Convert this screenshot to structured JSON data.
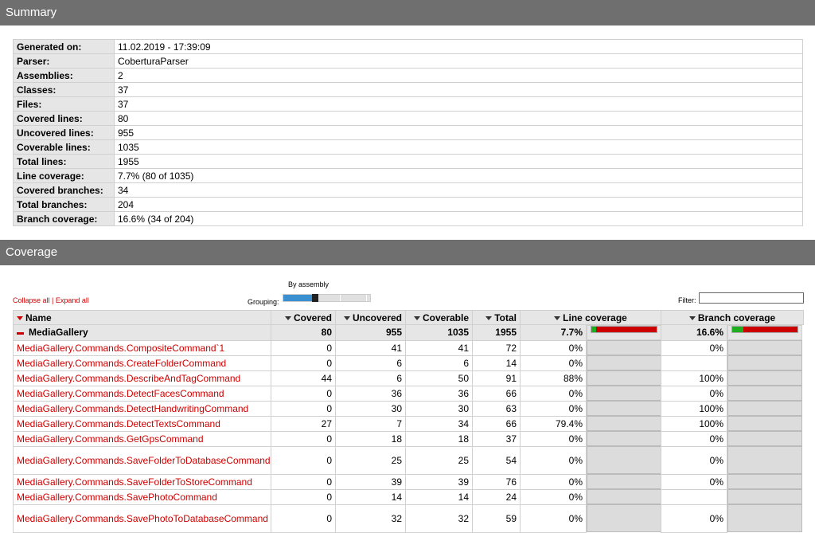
{
  "summary_title": "Summary",
  "summary": [
    {
      "label": "Generated on:",
      "value": "11.02.2019 - 17:39:09"
    },
    {
      "label": "Parser:",
      "value": "CoberturaParser"
    },
    {
      "label": "Assemblies:",
      "value": "2"
    },
    {
      "label": "Classes:",
      "value": "37"
    },
    {
      "label": "Files:",
      "value": "37"
    },
    {
      "label": "Covered lines:",
      "value": "80"
    },
    {
      "label": "Uncovered lines:",
      "value": "955"
    },
    {
      "label": "Coverable lines:",
      "value": "1035"
    },
    {
      "label": "Total lines:",
      "value": "1955"
    },
    {
      "label": "Line coverage:",
      "value": "7.7% (80 of 1035)"
    },
    {
      "label": "Covered branches:",
      "value": "34"
    },
    {
      "label": "Total branches:",
      "value": "204"
    },
    {
      "label": "Branch coverage:",
      "value": "16.6% (34 of 204)"
    }
  ],
  "coverage_title": "Coverage",
  "controls": {
    "grouping_title": "By assembly",
    "grouping_label": "Grouping:",
    "grouping_level": 0.33,
    "collapse_all": "Collapse all",
    "separator": "|",
    "expand_all": "Expand all",
    "filter_label": "Filter:",
    "filter_value": ""
  },
  "columns": {
    "name": "Name",
    "covered": "Covered",
    "uncovered": "Uncovered",
    "coverable": "Coverable",
    "total": "Total",
    "line_coverage": "Line coverage",
    "branch_coverage": "Branch coverage"
  },
  "group": {
    "name": "MediaGallery",
    "covered": "80",
    "uncovered": "955",
    "coverable": "1035",
    "total": "1955",
    "line_coverage": "7.7%",
    "line_coverage_value": 7.7,
    "branch_coverage": "16.6%",
    "branch_coverage_value": 16.6
  },
  "rows": [
    {
      "name": "MediaGallery.Commands.CompositeCommand`1",
      "covered": "0",
      "uncovered": "41",
      "coverable": "41",
      "total": "72",
      "line": "0%",
      "line_value": 0,
      "branch": "0%",
      "branch_value": 0
    },
    {
      "name": "MediaGallery.Commands.CreateFolderCommand",
      "covered": "0",
      "uncovered": "6",
      "coverable": "6",
      "total": "14",
      "line": "0%",
      "line_value": 0,
      "branch": "",
      "branch_value": null
    },
    {
      "name": "MediaGallery.Commands.DescribeAndTagCommand",
      "covered": "44",
      "uncovered": "6",
      "coverable": "50",
      "total": "91",
      "line": "88%",
      "line_value": 88,
      "branch": "100%",
      "branch_value": 100
    },
    {
      "name": "MediaGallery.Commands.DetectFacesCommand",
      "covered": "0",
      "uncovered": "36",
      "coverable": "36",
      "total": "66",
      "line": "0%",
      "line_value": 0,
      "branch": "0%",
      "branch_value": 0
    },
    {
      "name": "MediaGallery.Commands.DetectHandwritingCommand",
      "covered": "0",
      "uncovered": "30",
      "coverable": "30",
      "total": "63",
      "line": "0%",
      "line_value": 0,
      "branch": "100%",
      "branch_value": 100
    },
    {
      "name": "MediaGallery.Commands.DetectTextsCommand",
      "covered": "27",
      "uncovered": "7",
      "coverable": "34",
      "total": "66",
      "line": "79.4%",
      "line_value": 79.4,
      "branch": "100%",
      "branch_value": 100
    },
    {
      "name": "MediaGallery.Commands.GetGpsCommand",
      "covered": "0",
      "uncovered": "18",
      "coverable": "18",
      "total": "37",
      "line": "0%",
      "line_value": 0,
      "branch": "0%",
      "branch_value": 0
    },
    {
      "name": "MediaGallery.Commands.SaveFolderToDatabaseCommand",
      "covered": "0",
      "uncovered": "25",
      "coverable": "25",
      "total": "54",
      "line": "0%",
      "line_value": 0,
      "branch": "0%",
      "branch_value": 0,
      "tall": true
    },
    {
      "name": "MediaGallery.Commands.SaveFolderToStoreCommand",
      "covered": "0",
      "uncovered": "39",
      "coverable": "39",
      "total": "76",
      "line": "0%",
      "line_value": 0,
      "branch": "0%",
      "branch_value": 0
    },
    {
      "name": "MediaGallery.Commands.SavePhotoCommand",
      "covered": "0",
      "uncovered": "14",
      "coverable": "14",
      "total": "24",
      "line": "0%",
      "line_value": 0,
      "branch": "",
      "branch_value": null
    },
    {
      "name": "MediaGallery.Commands.SavePhotoToDatabaseCommand",
      "covered": "0",
      "uncovered": "32",
      "coverable": "32",
      "total": "59",
      "line": "0%",
      "line_value": 0,
      "branch": "0%",
      "branch_value": 0,
      "tall": true
    }
  ],
  "colors": {
    "covered": "#1fae1f",
    "uncovered": "#cc0000",
    "header_bg": "#6f6f6f",
    "link": "#cc0000"
  }
}
